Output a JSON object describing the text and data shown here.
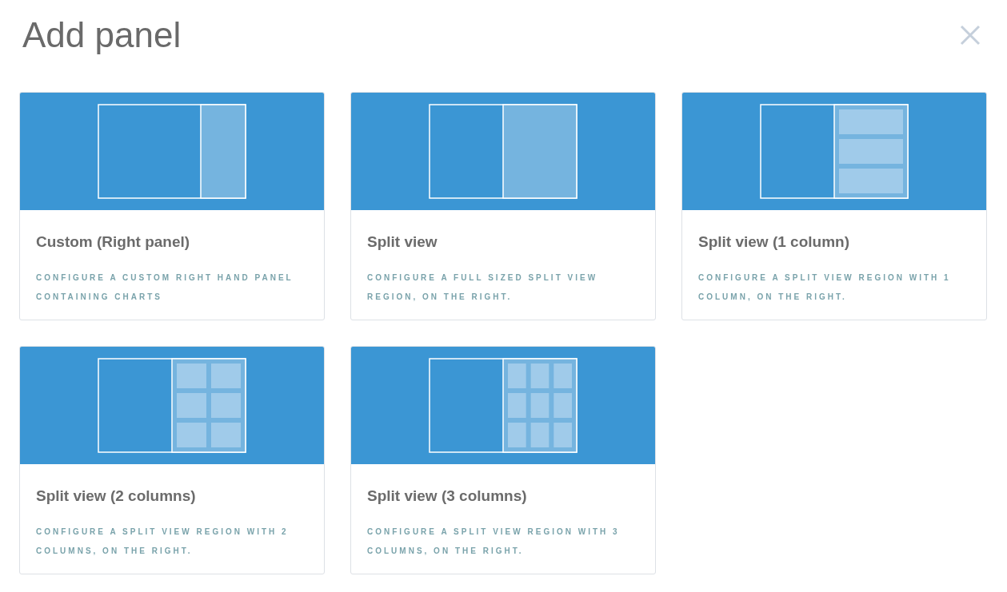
{
  "title": "Add panel",
  "cards": [
    {
      "kind": "right-panel",
      "title": "Custom (Right panel)",
      "description": "CONFIGURE A CUSTOM RIGHT HAND PANEL CONTAINING CHARTS"
    },
    {
      "kind": "split",
      "title": "Split view",
      "description": "CONFIGURE A FULL SIZED SPLIT VIEW REGION, ON THE RIGHT."
    },
    {
      "kind": "one-column",
      "title": "Split view (1 column)",
      "description": "CONFIGURE A SPLIT VIEW REGION WITH 1 COLUMN, ON THE RIGHT."
    },
    {
      "kind": "two-columns",
      "title": "Split view (2 columns)",
      "description": "CONFIGURE A SPLIT VIEW REGION WITH 2 COLUMNS, ON THE RIGHT."
    },
    {
      "kind": "three-columns",
      "title": "Split view (3 columns)",
      "description": "CONFIGURE A SPLIT VIEW REGION WITH 3 COLUMNS, ON THE RIGHT."
    }
  ]
}
